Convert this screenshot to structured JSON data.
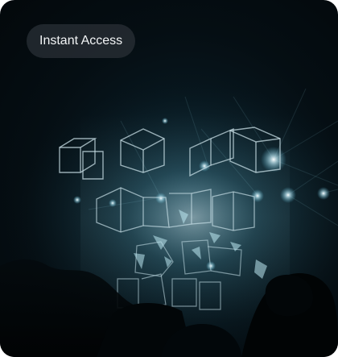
{
  "badge": {
    "label": "Instant Access"
  },
  "image": {
    "subject": "concert-stage-light-cubes"
  },
  "colors": {
    "badge_background": "#282e34",
    "badge_text": "#f2f4f5",
    "scene_glow": "#8fd3e8"
  }
}
